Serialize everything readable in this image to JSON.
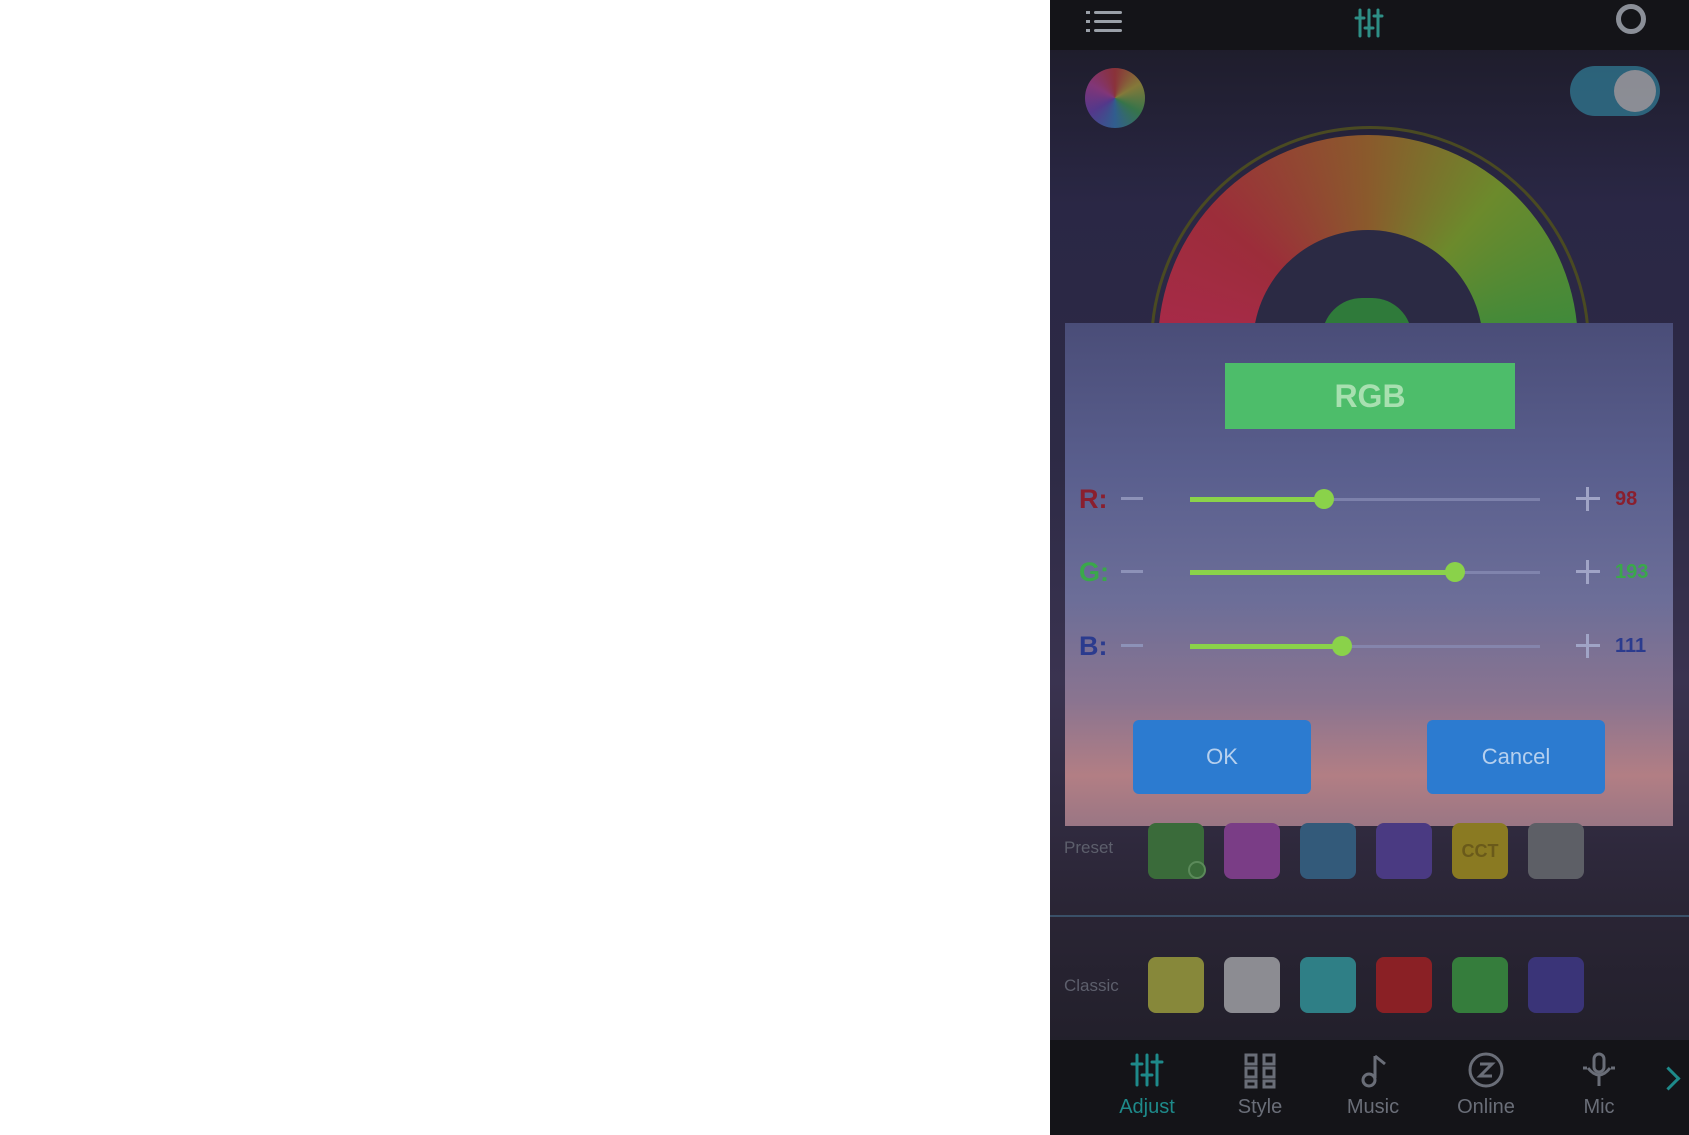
{
  "header": {
    "menu_icon": "menu-icon",
    "center_icon": "sliders-icon",
    "right_icon": "gear-icon"
  },
  "power_toggle": {
    "state": "on"
  },
  "dialog": {
    "title": "RGB",
    "rows": [
      {
        "label": "R:",
        "value": "98",
        "color": "#8a1f2e",
        "level": 0.384
      },
      {
        "label": "G:",
        "value": "193",
        "color": "#3aa84a",
        "level": 0.757
      },
      {
        "label": "B:",
        "value": "111",
        "color": "#2b3b8e",
        "level": 0.435
      }
    ],
    "ok_label": "OK",
    "cancel_label": "Cancel"
  },
  "preset": {
    "label": "Preset",
    "swatches": [
      {
        "color": "#3a6b3a",
        "text": ""
      },
      {
        "color": "#7a3d86",
        "text": ""
      },
      {
        "color": "#335a7a",
        "text": ""
      },
      {
        "color": "#4a3a82",
        "text": ""
      },
      {
        "color": "#8a7a22",
        "text": "CCT"
      },
      {
        "color": "#5d5f66",
        "text": ""
      }
    ]
  },
  "classic": {
    "label": "Classic",
    "swatches": [
      {
        "color": "#87883a"
      },
      {
        "color": "#8c8c92"
      },
      {
        "color": "#2f7f86"
      },
      {
        "color": "#8a2025"
      },
      {
        "color": "#357d3c"
      },
      {
        "color": "#3a3478"
      }
    ]
  },
  "tabs": [
    {
      "label": "Adjust",
      "icon": "sliders-icon",
      "active": true
    },
    {
      "label": "Style",
      "icon": "grid-icon",
      "active": false
    },
    {
      "label": "Music",
      "icon": "music-note-icon",
      "active": false
    },
    {
      "label": "Online",
      "icon": "online-icon",
      "active": false
    },
    {
      "label": "Mic",
      "icon": "microphone-icon",
      "active": false
    }
  ]
}
